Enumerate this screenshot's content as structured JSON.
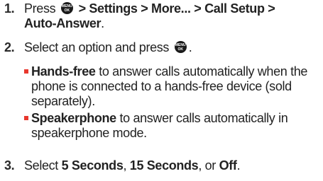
{
  "colors": {
    "bullet": "#e8372d",
    "text": "#222222",
    "key": "#1a1a1a"
  },
  "key_icon": {
    "name": "menu-ok-key-icon",
    "top": "MENU",
    "bottom": "OK"
  },
  "steps": [
    {
      "num": "1.",
      "press": "Press",
      "path": "> Settings > More... > Call Setup >",
      "path2": "Auto-Answer",
      "end": "."
    },
    {
      "num": "2.",
      "text": "Select an option and press",
      "end": "."
    },
    {
      "num": "3.",
      "text": "Select",
      "opt1": "5 Seconds",
      "sep1": ",",
      "opt2": "15 Seconds",
      "sep2": ", or",
      "opt3": "Off",
      "end": "."
    }
  ],
  "options": [
    {
      "term": "Hands-free",
      "desc": "to answer calls automatically when the phone is connected to a hands-free device (sold separately)."
    },
    {
      "term": "Speakerphone",
      "desc": "to answer calls automatically in speakerphone mode."
    }
  ]
}
